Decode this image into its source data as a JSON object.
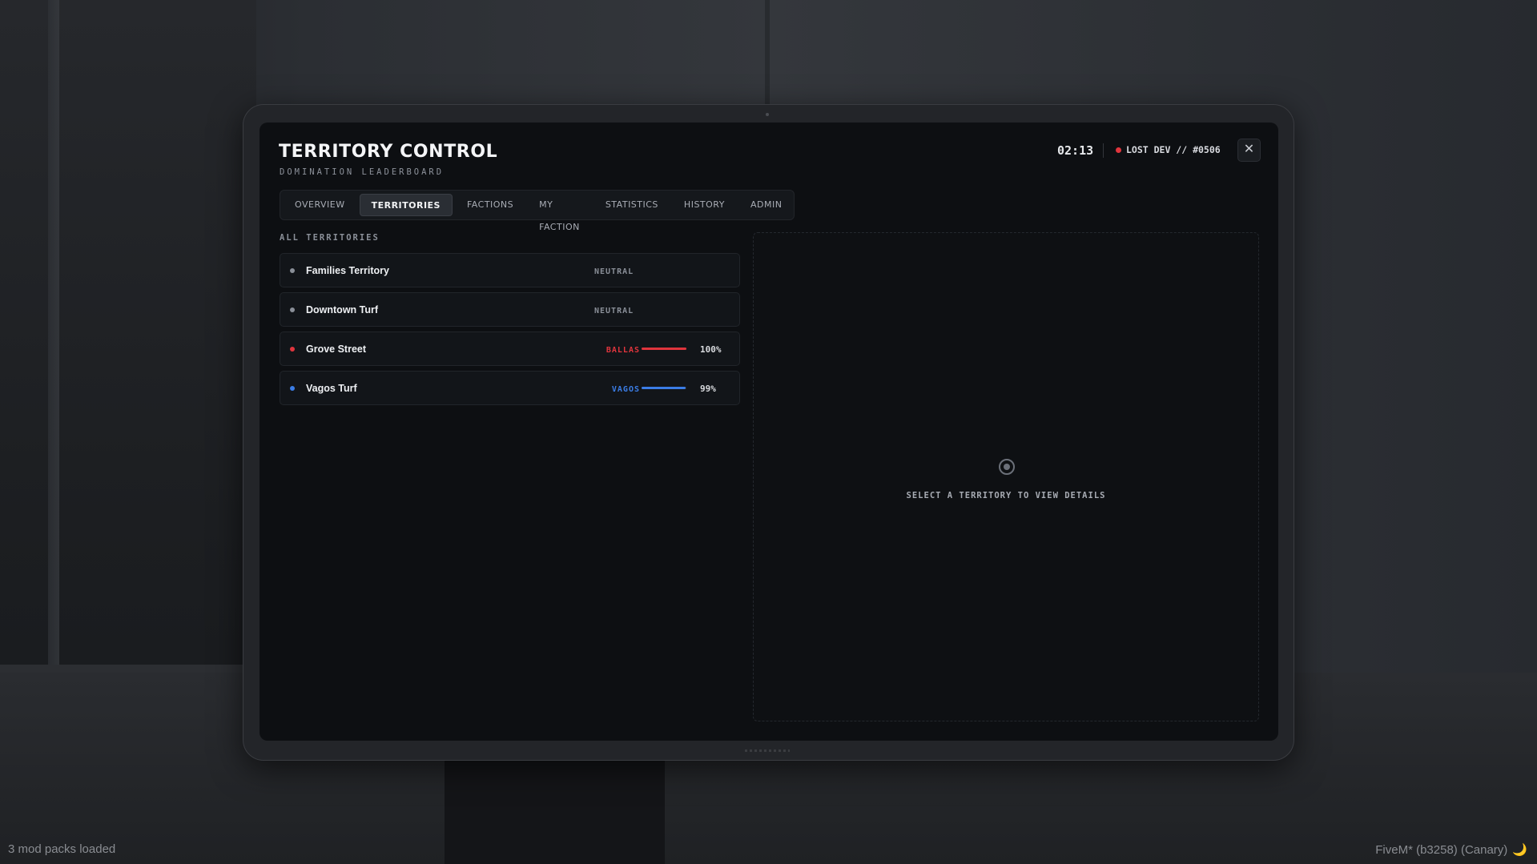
{
  "header": {
    "title": "TERRITORY CONTROL",
    "subtitle": "DOMINATION LEADERBOARD",
    "clock": "02:13",
    "server": "LOST DEV // #0506",
    "close_label": "✕"
  },
  "tabs": [
    {
      "label": "OVERVIEW",
      "active": false
    },
    {
      "label": "TERRITORIES",
      "active": true
    },
    {
      "label": "FACTIONS",
      "active": false
    },
    {
      "label": "MY FACTION",
      "active": false
    },
    {
      "label": "STATISTICS",
      "active": false
    },
    {
      "label": "HISTORY",
      "active": false
    },
    {
      "label": "ADMIN",
      "active": false
    }
  ],
  "section_label": "ALL TERRITORIES",
  "territories": [
    {
      "name": "Families Territory",
      "owner": "NEUTRAL",
      "percent": "",
      "control": null,
      "color": "#8a8f98"
    },
    {
      "name": "Downtown Turf",
      "owner": "NEUTRAL",
      "percent": "",
      "control": null,
      "color": "#8a8f98"
    },
    {
      "name": "Grove Street",
      "owner": "BALLAS",
      "percent": "100%",
      "control": 1.0,
      "color": "#e0353d"
    },
    {
      "name": "Vagos Turf",
      "owner": "VAGOS",
      "percent": "99%",
      "control": 0.99,
      "color": "#3b7de6"
    }
  ],
  "details": {
    "icon": "target-icon",
    "empty_text": "SELECT A TERRITORY TO VIEW DETAILS"
  },
  "overlay": {
    "mods": "3 mod packs loaded",
    "build": "FiveM* (b3258) (Canary)",
    "moon_icon": "🌙"
  }
}
